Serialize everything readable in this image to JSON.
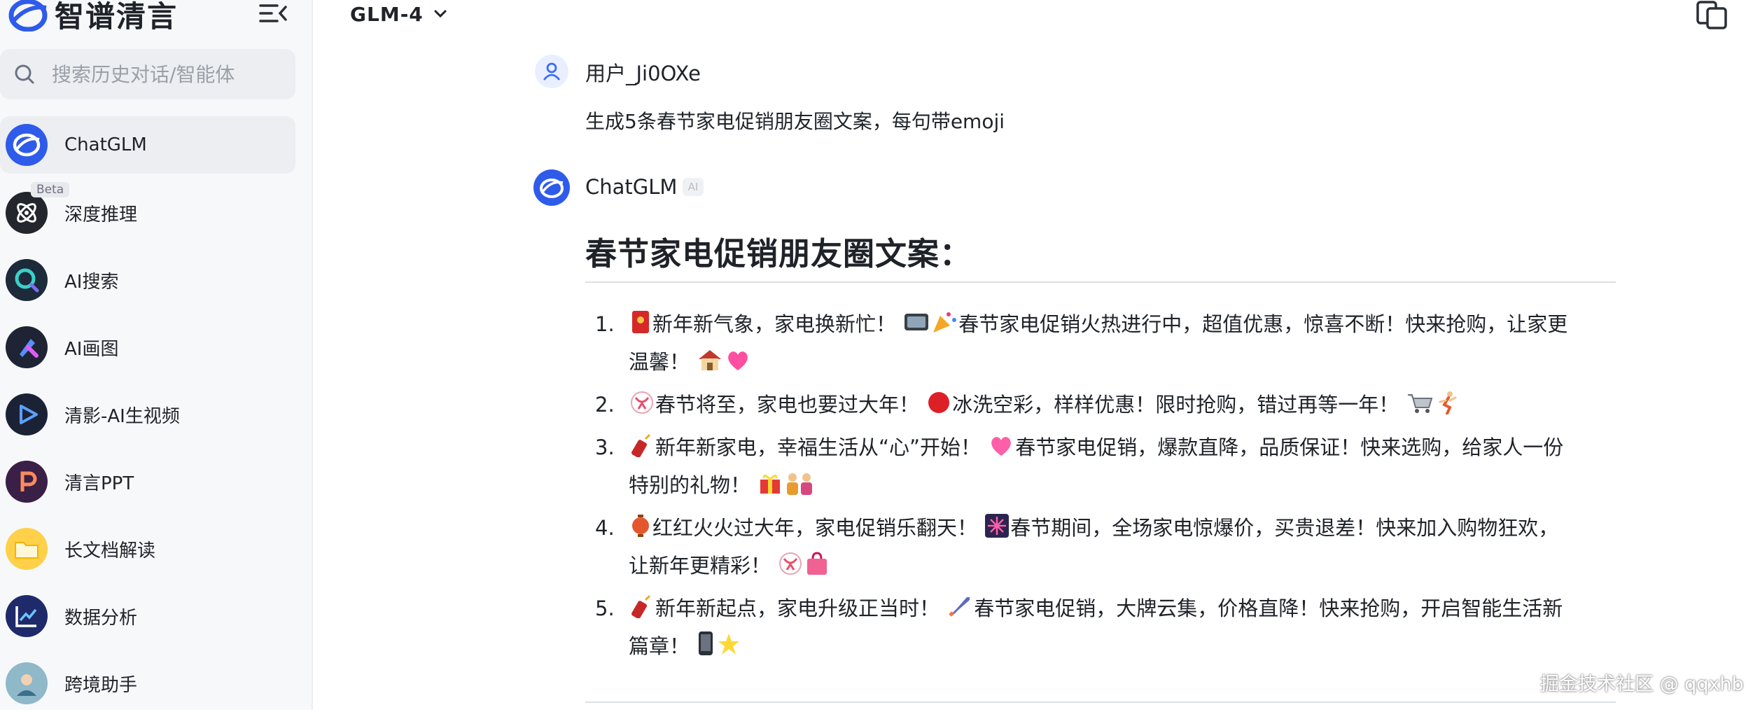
{
  "app": {
    "brand_name": "智谱清言"
  },
  "sidebar": {
    "search_placeholder": "搜索历史对话/智能体",
    "items": [
      {
        "label": "ChatGLM",
        "active": true
      },
      {
        "label": "深度推理",
        "badge": "Beta"
      },
      {
        "label": "AI搜索"
      },
      {
        "label": "AI画图"
      },
      {
        "label": "清影-AI生视频"
      },
      {
        "label": "清言PPT"
      },
      {
        "label": "长文档解读"
      },
      {
        "label": "数据分析"
      },
      {
        "label": "跨境助手"
      }
    ]
  },
  "header": {
    "model": "GLM-4"
  },
  "chat": {
    "user_name": "用户_Ji0OXe",
    "user_message": "生成5条春节家电促销朋友圈文案，每句带emoji",
    "ai_name": "ChatGLM",
    "ai_badge": "AI",
    "answer_title": "春节家电促销朋友圈文案：",
    "items": [
      {
        "num": "1.",
        "line1": "新年新气象，家电换新忙！",
        "line2": "春节家电促销火热进行中，超值优惠，惊喜不断！快来抢购，让家更",
        "line3": "温馨！",
        "emojis": [
          "red-envelope-emoji",
          "television-emoji",
          "party-popper-emoji",
          "house-emoji",
          "heart-emoji"
        ]
      },
      {
        "num": "2.",
        "line1": "春节将至，家电也要过大年！",
        "line2": "冰洗空彩，样样优惠！限时抢购，错过再等一年！",
        "emojis": [
          "ribbon-emoji",
          "red-circle-emoji",
          "cart-emoji",
          "running-emoji"
        ]
      },
      {
        "num": "3.",
        "line1": "新年新家电，幸福生活从“心”开始！",
        "line2": "春节家电促销，爆款直降，品质保证！快来选购，给家人一份",
        "line3": "特别的礼物！",
        "emojis": [
          "firecracker-emoji",
          "heart-emoji",
          "gift-emoji",
          "family-emoji"
        ]
      },
      {
        "num": "4.",
        "line1": "红红火火过大年，家电促销乐翻天！",
        "line2": "春节期间，全场家电惊爆价，买贵退差！快来加入购物狂欢，",
        "line3": "让新年更精彩！",
        "emojis": [
          "lantern-emoji",
          "fireworks-emoji",
          "ribbon-emoji",
          "shopping-bag-emoji"
        ]
      },
      {
        "num": "5.",
        "line1": "新年新起点，家电升级正当时！",
        "line2": "春节家电促销，大牌云集，价格直降！快来抢购，开启智能生活新",
        "line3": "篇章！",
        "emojis": [
          "firecracker-emoji",
          "rocket-emoji",
          "phone-emoji",
          "star-emoji"
        ]
      }
    ]
  },
  "watermark": "掘金技术社区 @ qqxhb"
}
